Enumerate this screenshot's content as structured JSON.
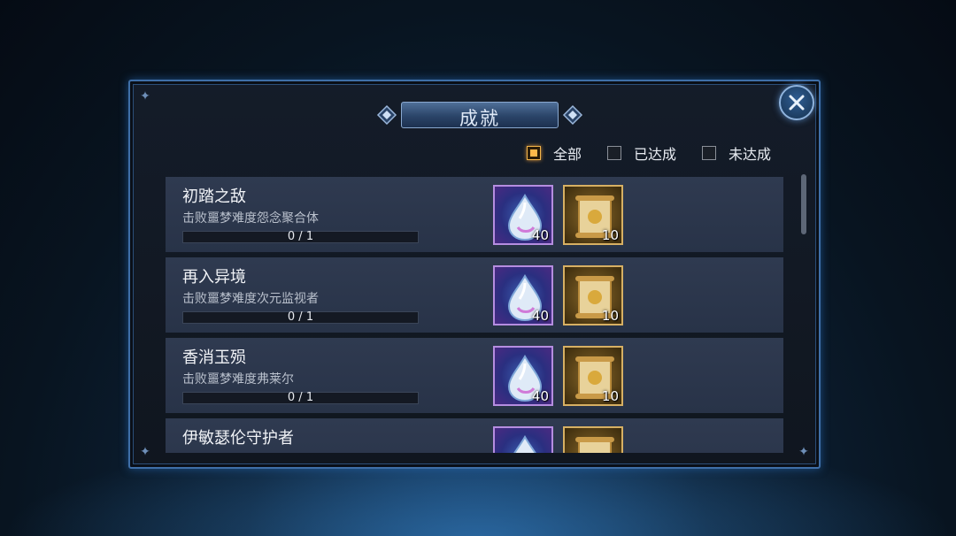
{
  "window": {
    "title": "成就"
  },
  "filters": [
    {
      "label": "全部",
      "checked": true
    },
    {
      "label": "已达成",
      "checked": false
    },
    {
      "label": "未达成",
      "checked": false
    }
  ],
  "achievements": [
    {
      "name": "初踏之敌",
      "desc": "击败噩梦难度怨念聚合体",
      "progress": "0 / 1",
      "progress_value": 0,
      "rewards": [
        {
          "icon": "crystal-gem-icon",
          "qty": "40"
        },
        {
          "icon": "gold-scroll-icon",
          "qty": "10"
        }
      ]
    },
    {
      "name": "再入异境",
      "desc": "击败噩梦难度次元监视者",
      "progress": "0 / 1",
      "progress_value": 0,
      "rewards": [
        {
          "icon": "crystal-gem-icon",
          "qty": "40"
        },
        {
          "icon": "gold-scroll-icon",
          "qty": "10"
        }
      ]
    },
    {
      "name": "香消玉殒",
      "desc": "击败噩梦难度弗莱尔",
      "progress": "0 / 1",
      "progress_value": 0,
      "rewards": [
        {
          "icon": "crystal-gem-icon",
          "qty": "40"
        },
        {
          "icon": "gold-scroll-icon",
          "qty": "10"
        }
      ]
    },
    {
      "name": "伊敏瑟伦守护者",
      "desc": "",
      "progress": "",
      "progress_value": 0,
      "rewards": [
        {
          "icon": "crystal-gem-icon",
          "qty": ""
        },
        {
          "icon": "gold-scroll-icon",
          "qty": ""
        }
      ]
    }
  ],
  "colors": {
    "accent": "#f4b54a",
    "frame": "#3f6fa8",
    "row_bg": "#2f3a50"
  }
}
